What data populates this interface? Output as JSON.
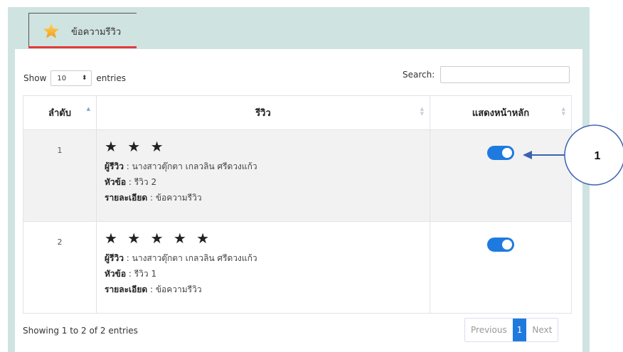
{
  "tab": {
    "label": "ข้อความรีวิว",
    "icon": "star-icon"
  },
  "controls": {
    "show_label": "Show",
    "entries_value": "10",
    "entries_label": "entries",
    "search_label": "Search:",
    "search_value": ""
  },
  "table": {
    "headers": [
      "ลำดับ",
      "รีวิว",
      "แสดงหน้าหลัก"
    ],
    "rows": [
      {
        "index": "1",
        "stars": "★ ★ ★",
        "star_count": 3,
        "reviewer_label": "ผู้รีวิว",
        "reviewer": "นางสาวตุ๊กตา เกลวลิน ศรีดวงแก้ว",
        "title_label": "หัวข้อ",
        "title": "รีวิว 2",
        "detail_label": "รายละเอียด",
        "detail": "ข้อความรีวิว",
        "show_home": true
      },
      {
        "index": "2",
        "stars": "★ ★ ★ ★ ★",
        "star_count": 5,
        "reviewer_label": "ผู้รีวิว",
        "reviewer": "นางสาวตุ๊กตา เกลวลิน ศรีดวงแก้ว",
        "title_label": "หัวข้อ",
        "title": "รีวิว 1",
        "detail_label": "รายละเอียด",
        "detail": "ข้อความรีวิว",
        "show_home": true
      }
    ]
  },
  "footer": {
    "info": "Showing 1 to 2 of 2 entries",
    "prev": "Previous",
    "page": "1",
    "next": "Next"
  },
  "annotation": {
    "label": "1"
  },
  "colors": {
    "panel": "#cfe3e1",
    "accent": "#1f7ae0",
    "tab_underline": "#e23b3b",
    "annotation_arrow": "#3b63b0"
  }
}
